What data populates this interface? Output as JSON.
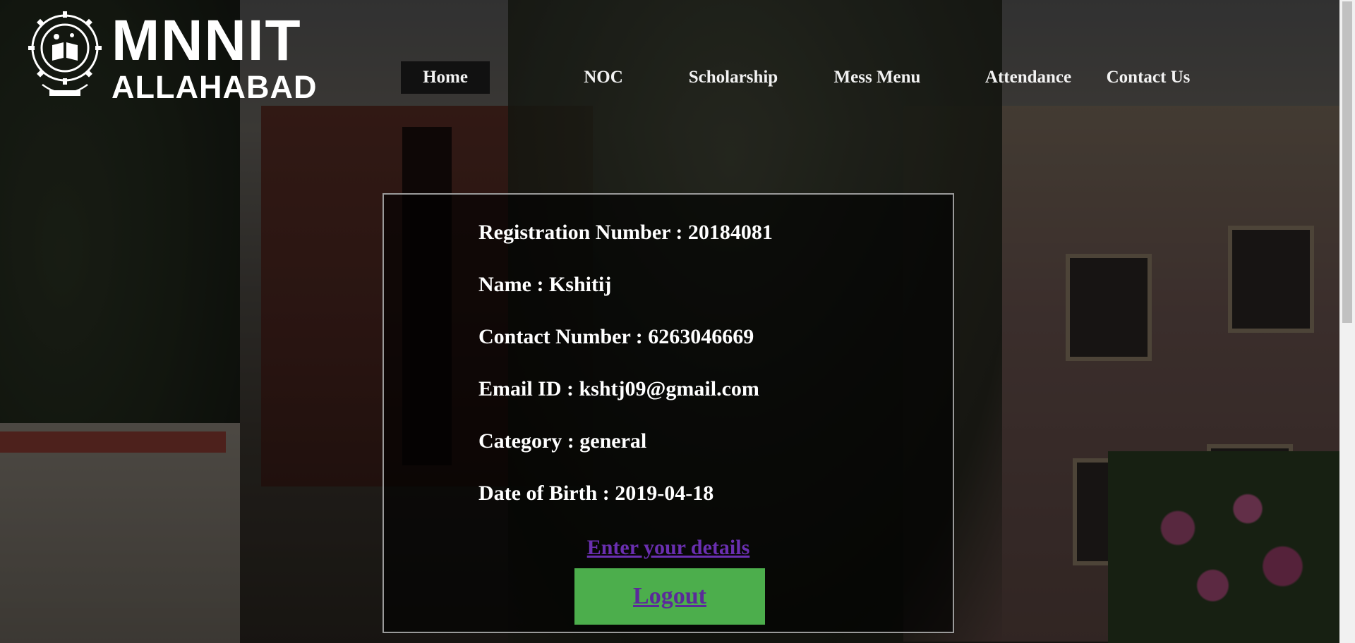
{
  "logo": {
    "line1": "MNNIT",
    "line2": "ALLAHABAD",
    "seal_icon": "institute-seal-icon"
  },
  "nav": {
    "items": [
      {
        "label": "Home",
        "active": true
      },
      {
        "label": "NOC",
        "active": false
      },
      {
        "label": "Scholarship",
        "active": false
      },
      {
        "label": "Mess Menu",
        "active": false
      },
      {
        "label": "Attendance",
        "active": false
      },
      {
        "label": "Contact Us",
        "active": false
      }
    ]
  },
  "profile": {
    "registration": "Registration Number : 20184081",
    "name": "Name : Kshitij",
    "contact": "Contact Number : 6263046669",
    "email": "Email ID : kshtj09@gmail.com",
    "category": "Category : general",
    "dob": "Date of Birth : 2019-04-18"
  },
  "actions": {
    "enter_details": "Enter your details",
    "logout": "Logout"
  },
  "colors": {
    "card_border": "#9a9a9a",
    "link": "#6a2fb0",
    "logout_bg": "#4cae4c",
    "nav_active_bg": "#111111"
  }
}
